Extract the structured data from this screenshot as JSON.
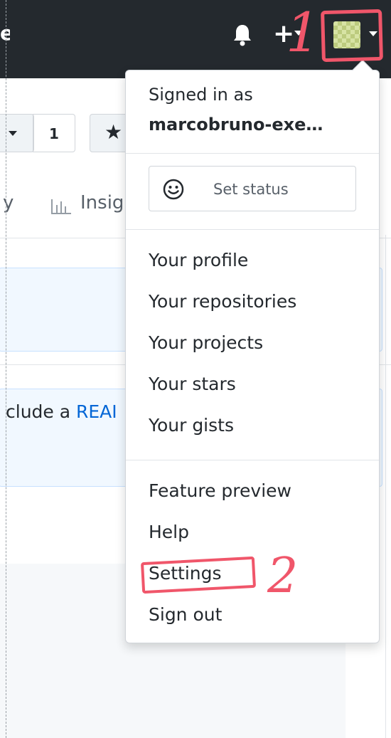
{
  "header": {
    "cut_title": "e",
    "plus_label": "+"
  },
  "repo": {
    "fork_count": "1",
    "star_glyph": "★",
    "tab_partial": "y",
    "insights_partial": "Insig"
  },
  "readme_banner": {
    "text_before": "clude a ",
    "link_partial": "REAI"
  },
  "user_menu": {
    "signed_in_as": "Signed in as",
    "username": "marcobruno-exe…",
    "set_status": "Set status",
    "items": [
      "Your profile",
      "Your repositories",
      "Your projects",
      "Your stars",
      "Your gists"
    ],
    "feature_preview": "Feature preview",
    "help": "Help",
    "settings": "Settings",
    "sign_out": "Sign out"
  },
  "annotations": {
    "step_1": "1",
    "step_2": "2"
  },
  "colors": {
    "header_bg": "#24292e",
    "annotation_red": "#f0566a",
    "link_blue": "#0366d6"
  }
}
